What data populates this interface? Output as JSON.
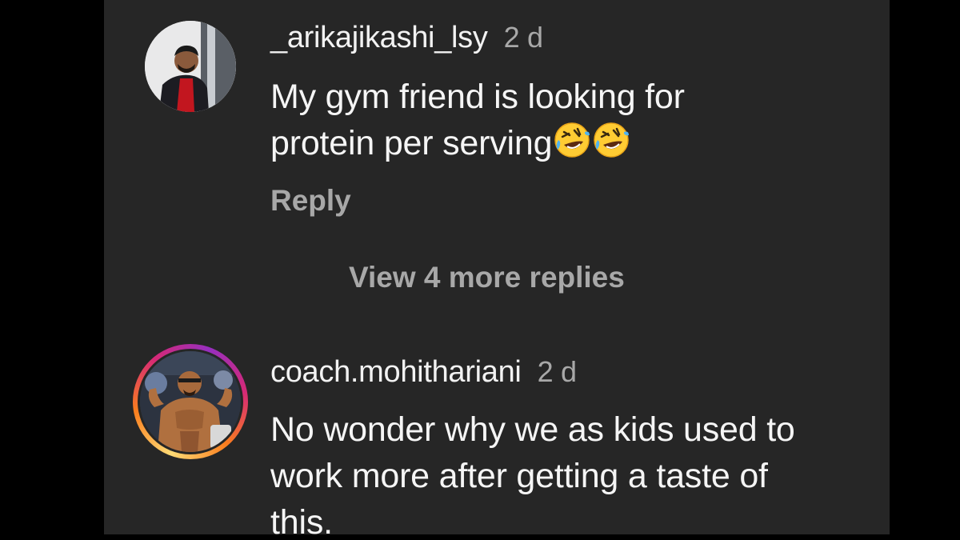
{
  "comments": [
    {
      "username": "_arikajikashi_lsy",
      "time": "2 d",
      "text_line1": "My gym friend is looking for",
      "text_line2": "protein per serving",
      "emojis": [
        "rolling-on-floor-laughing-emoji",
        "rolling-on-floor-laughing-emoji"
      ],
      "reply_label": "Reply",
      "view_replies_label": "View 4 more replies"
    },
    {
      "username": "coach.mohithariani",
      "time": "2 d",
      "text_line1": "No wonder why we as kids used to",
      "text_line2": "work more after getting a taste of",
      "text_line3": "this.",
      "has_story_ring": true
    }
  ],
  "colors": {
    "panel_bg": "#262626",
    "outer_bg": "#000000",
    "primary_text": "#f5f5f5",
    "secondary_text": "#a8a8a8",
    "story_ring": [
      "#feda75",
      "#fa7e1e",
      "#d62976",
      "#962fbf"
    ]
  }
}
